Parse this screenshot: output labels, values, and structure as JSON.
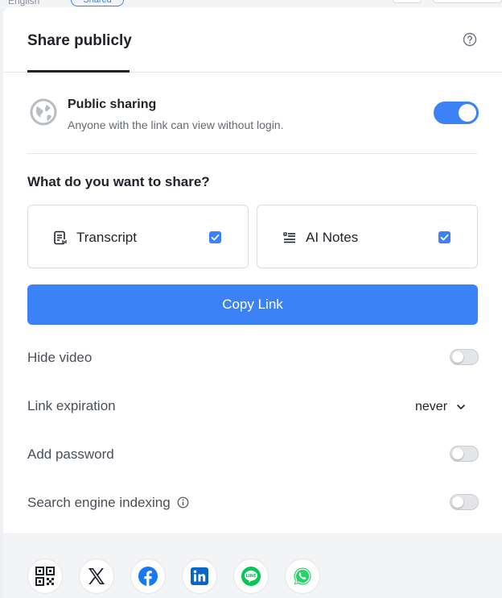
{
  "background": {
    "language": "English",
    "badge": "Shared"
  },
  "header": {
    "title": "Share publicly",
    "help_icon": "help-circle-icon"
  },
  "public_sharing": {
    "title": "Public sharing",
    "description": "Anyone with the link can view without login.",
    "enabled": true,
    "icon": "globe-icon"
  },
  "share_section": {
    "question": "What do you want to share?",
    "options": [
      {
        "label": "Transcript",
        "checked": true,
        "icon": "transcript-icon"
      },
      {
        "label": "AI Notes",
        "checked": true,
        "icon": "notes-list-icon"
      }
    ]
  },
  "copy_link": {
    "label": "Copy Link"
  },
  "settings": {
    "hide_video": {
      "label": "Hide video",
      "enabled": false
    },
    "link_expiration": {
      "label": "Link expiration",
      "value": "never"
    },
    "add_password": {
      "label": "Add password",
      "enabled": false
    },
    "search_indexing": {
      "label": "Search engine indexing",
      "enabled": false
    }
  },
  "social": [
    {
      "name": "qr-code-icon"
    },
    {
      "name": "x-logo-icon"
    },
    {
      "name": "facebook-icon"
    },
    {
      "name": "linkedin-icon"
    },
    {
      "name": "line-icon"
    },
    {
      "name": "whatsapp-icon"
    }
  ],
  "colors": {
    "accent": "#3b82f6",
    "facebook": "#1877f2",
    "linkedin": "#0a66c2",
    "line": "#06c755",
    "whatsapp": "#25d366"
  }
}
